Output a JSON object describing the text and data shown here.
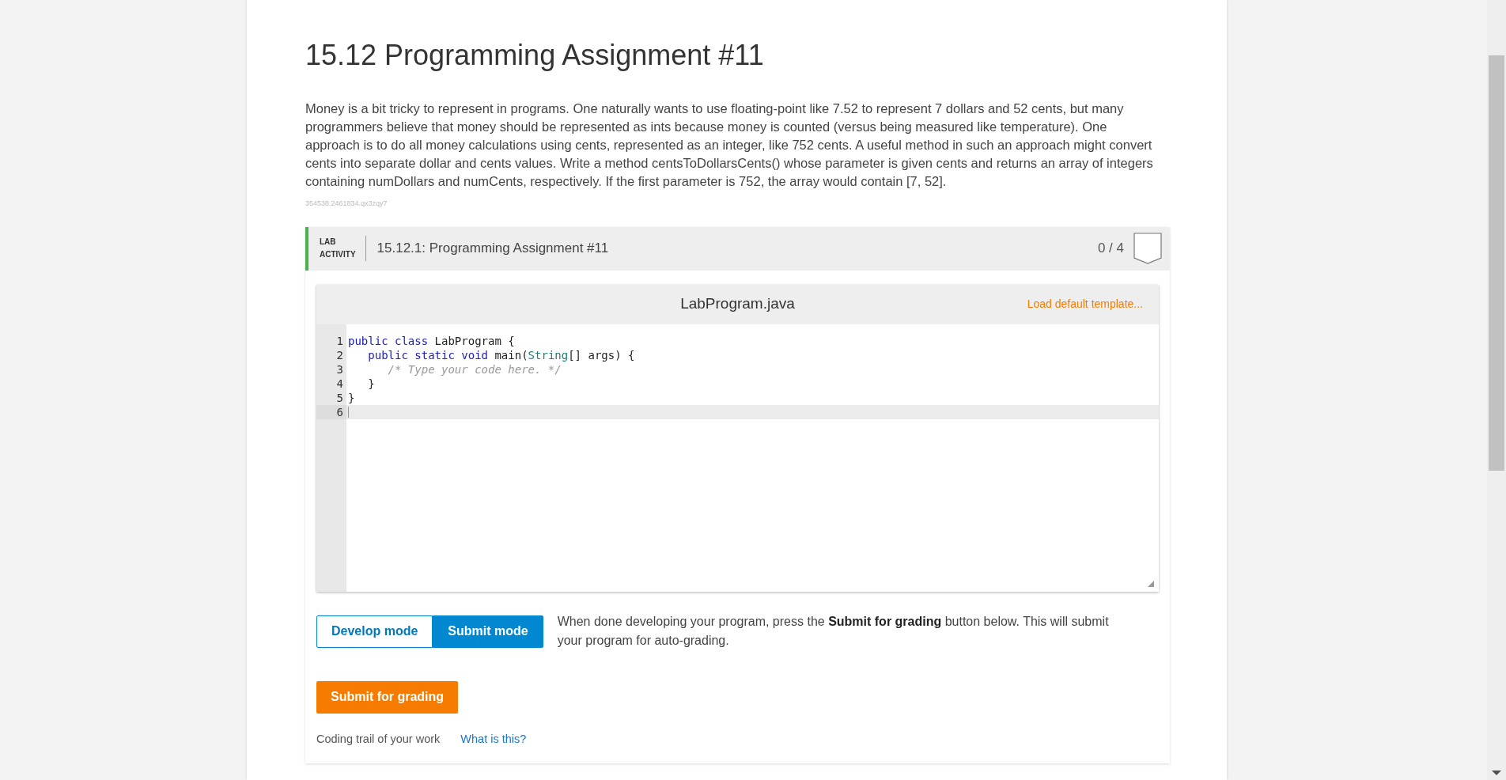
{
  "title": "15.12 Programming Assignment #11",
  "description": "Money is a bit tricky to represent in programs. One naturally wants to use floating-point like 7.52 to represent 7 dollars and 52 cents, but many programmers believe that money should be represented as ints because money is counted (versus being measured like temperature). One approach is to do all money calculations using cents, represented as an integer, like 752 cents. A useful method in such an approach might convert cents into separate dollar and cents values. Write a method centsToDollarsCents() whose parameter is given cents and returns an array of integers containing numDollars and numCents, respectively. If the first parameter is 752, the array would contain [7, 52].",
  "section_id": "354538.2461834.qx3zqy7",
  "lab": {
    "label_lines": [
      "LAB",
      "ACTIVITY"
    ],
    "title": "15.12.1: Programming Assignment #11",
    "score": "0 / 4"
  },
  "editor": {
    "filename": "LabProgram.java",
    "load_template": "Load default template...",
    "lines": [
      {
        "number": "1",
        "current": false,
        "tokens": [
          {
            "kind": "keyword",
            "text": "public class"
          },
          {
            "kind": "plain",
            "text": " LabProgram {"
          }
        ]
      },
      {
        "number": "2",
        "current": false,
        "tokens": [
          {
            "kind": "keyword",
            "text": "   public static void"
          },
          {
            "kind": "plain",
            "text": " main("
          },
          {
            "kind": "type",
            "text": "String"
          },
          {
            "kind": "plain",
            "text": "[] args) {"
          }
        ]
      },
      {
        "number": "3",
        "current": false,
        "tokens": [
          {
            "kind": "comment",
            "text": "      /* Type your code here. */"
          }
        ]
      },
      {
        "number": "4",
        "current": false,
        "tokens": [
          {
            "kind": "plain",
            "text": "   }"
          }
        ]
      },
      {
        "number": "5",
        "current": false,
        "tokens": [
          {
            "kind": "plain",
            "text": "}"
          }
        ]
      },
      {
        "number": "6",
        "current": true
      }
    ]
  },
  "modes": [
    {
      "label": "Develop mode",
      "selected": false
    },
    {
      "label": "Submit mode",
      "selected": true
    }
  ],
  "mode_hint": "When done developing your program, press the **Submit for grading** button below. This will submit your program for auto-grading.",
  "submit_button": "Submit for grading",
  "coding_trail": {
    "label": "Coding trail of your work",
    "link": "What is this?"
  }
}
